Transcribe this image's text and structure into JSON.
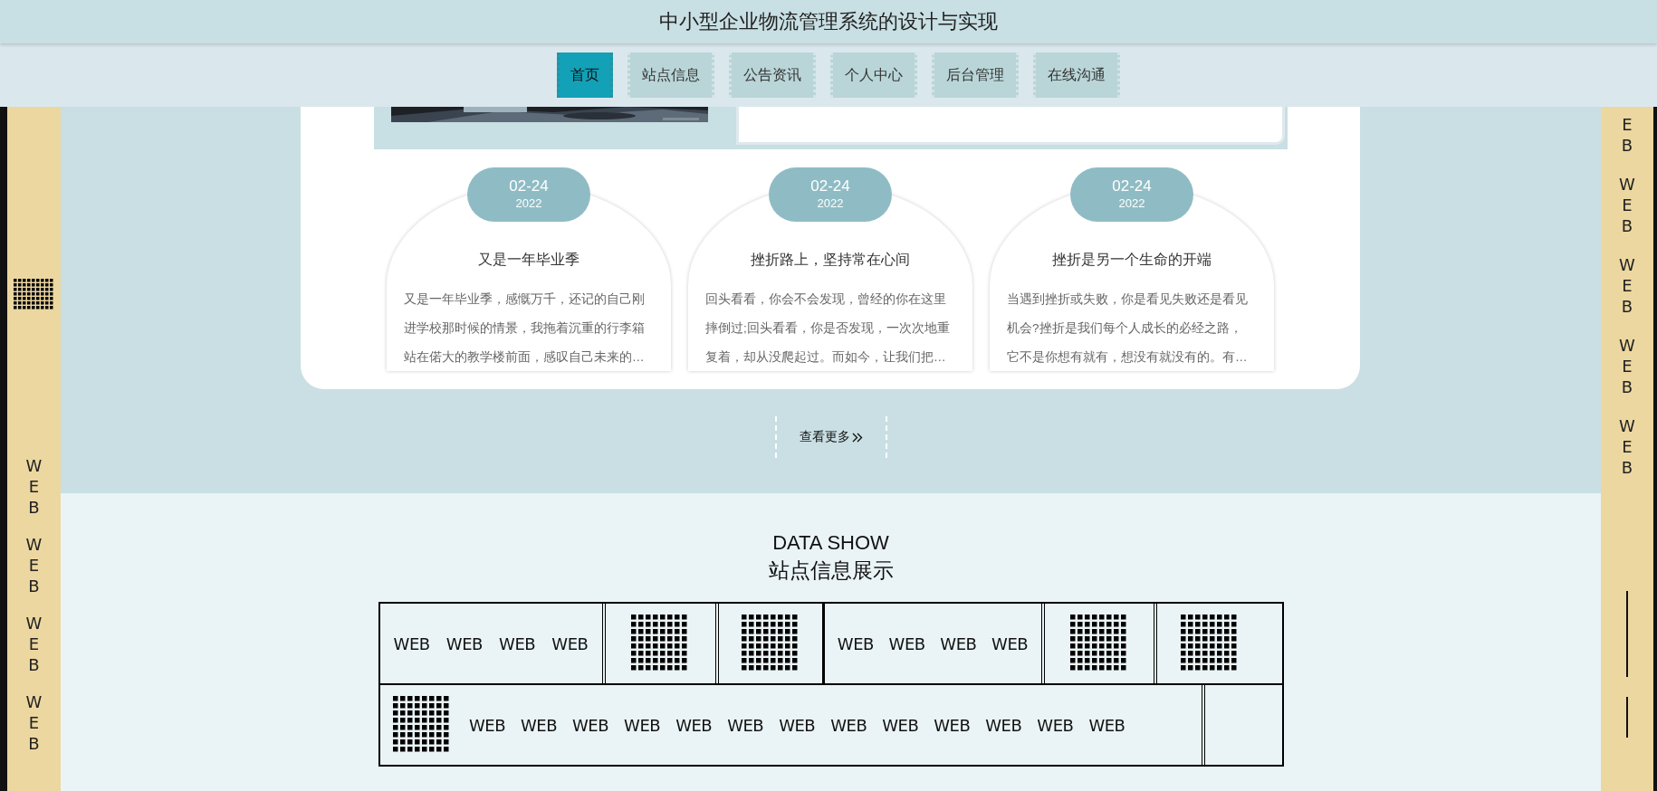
{
  "header": {
    "title": "中小型企业物流管理系统的设计与实现"
  },
  "nav": [
    {
      "label": "首页",
      "selected": true
    },
    {
      "label": "站点信息",
      "selected": false
    },
    {
      "label": "公告资讯",
      "selected": false
    },
    {
      "label": "个人中心",
      "selected": false
    },
    {
      "label": "后台管理",
      "selected": false
    },
    {
      "label": "在线沟通",
      "selected": false
    }
  ],
  "side_left": [
    {
      "kind": "grid"
    },
    {
      "kind": "text",
      "text": "WEB"
    },
    {
      "kind": "text",
      "text": "WEB"
    },
    {
      "kind": "text",
      "text": "WEB"
    },
    {
      "kind": "text",
      "text": "WEB"
    }
  ],
  "side_right": [
    {
      "kind": "text",
      "text": "EB"
    },
    {
      "kind": "text",
      "text": "WEB"
    },
    {
      "kind": "text",
      "text": "WEB"
    },
    {
      "kind": "text",
      "text": "WEB"
    },
    {
      "kind": "text",
      "text": "WEB"
    },
    {
      "kind": "line"
    },
    {
      "kind": "line"
    }
  ],
  "news": [
    {
      "date": "02-24",
      "year": "2022",
      "title": "又是一年毕业季",
      "excerpt": "又是一年毕业季，感慨万千，还记的自己刚进学校那时候的情景，我拖着沉重的行李箱站在偌大的教学楼前面，感叹自己未来的…"
    },
    {
      "date": "02-24",
      "year": "2022",
      "title": "挫折路上，坚持常在心间",
      "excerpt": "回头看看，你会不会发现，曾经的你在这里摔倒过;回头看看，你是否发现，一次次地重复着，却从没爬起过。而如今，让我们把…"
    },
    {
      "date": "02-24",
      "year": "2022",
      "title": "挫折是另一个生命的开端",
      "excerpt": "当遇到挫折或失败，你是看见失败还是看见机会?挫折是我们每个人成长的必经之路，它不是你想有就有，想没有就没有的。有…"
    }
  ],
  "more": {
    "label": "查看更多"
  },
  "data_show": {
    "title": "DATA SHOW",
    "subtitle": "站点信息展示",
    "rows": [
      [
        {
          "kind": "words",
          "words": [
            "WEB",
            "WEB",
            "WEB",
            "WEB"
          ]
        },
        {
          "kind": "grid"
        },
        {
          "kind": "grid"
        },
        {
          "kind": "words",
          "words": [
            "WEB",
            "WEB",
            "WEB",
            "WEB"
          ]
        },
        {
          "kind": "grid"
        },
        {
          "kind": "grid"
        }
      ],
      [
        {
          "kind": "grid_words",
          "words": [
            "WEB",
            "WEB",
            "WEB",
            "WEB",
            "WEB",
            "WEB",
            "WEB",
            "WEB",
            "WEB",
            "WEB",
            "WEB",
            "WEB",
            "WEB"
          ]
        },
        {
          "kind": "empty"
        }
      ]
    ]
  }
}
